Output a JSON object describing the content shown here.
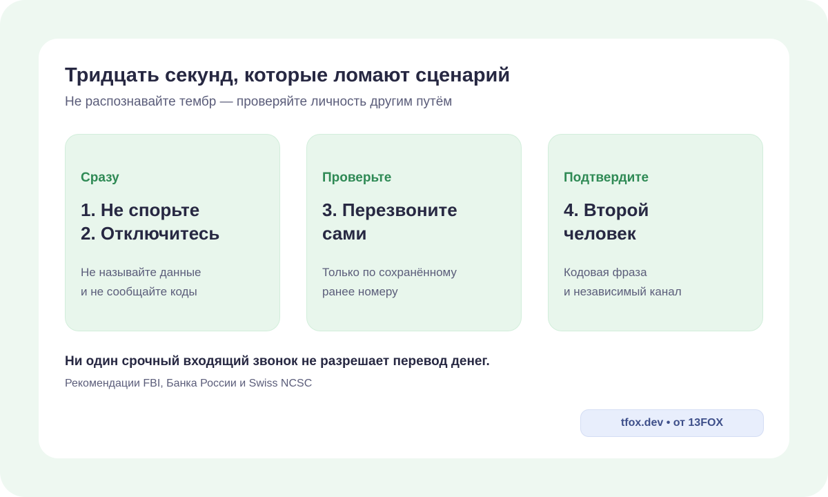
{
  "header": {
    "title": "Тридцать секунд, которые ломают сценарий",
    "subtitle": "Не распознавайте тембр — проверяйте личность другим путём"
  },
  "steps": [
    {
      "tag": "Сразу",
      "heading": [
        "1. Не спорьте",
        "2. Отключитесь"
      ],
      "body": [
        "Не называйте данные",
        "и не сообщайте коды"
      ]
    },
    {
      "tag": "Проверьте",
      "heading": [
        "3. Перезвоните",
        "сами"
      ],
      "body": [
        "Только по сохранённому",
        "ранее номеру"
      ]
    },
    {
      "tag": "Подтвердите",
      "heading": [
        "4. Второй",
        "человек"
      ],
      "body": [
        "Кодовая фраза",
        "и независимый канал"
      ]
    }
  ],
  "footer": {
    "note": "Ни один срочный входящий звонок не разрешает перевод денег.",
    "sources": "Рекомендации FBI, Банка России и Swiss NCSC"
  },
  "brand": {
    "label": "tfox.dev • от 13FOX"
  },
  "colors": {
    "background": "#eef8f1",
    "card": "#ffffff",
    "step_card": "#e8f6ec",
    "accent_green": "#2f8a55",
    "heading_text": "#272842",
    "muted_text": "#5b5d7a",
    "brand_badge": "#e8eefc",
    "brand_text": "#3e4f8a"
  }
}
